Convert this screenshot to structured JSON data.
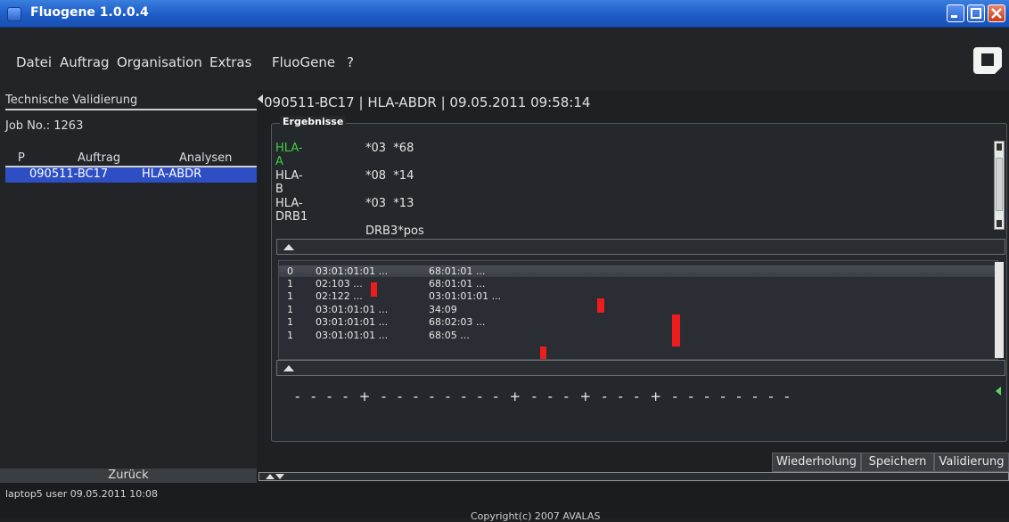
{
  "window": {
    "title": "Fluogene 1.0.0.4"
  },
  "menu": [
    "Datei",
    "Auftrag",
    "Organisation",
    "Extras",
    "FluoGene",
    "?"
  ],
  "left_panel": {
    "heading": "Technische Validierung",
    "job_no": "Job No.: 1263",
    "columns": [
      "P",
      "Auftrag",
      "Analysen"
    ],
    "rows": [
      {
        "p": "",
        "auftrag": "090511-BC17",
        "analysen": "HLA-ABDR",
        "selected": true
      }
    ],
    "back_button": "Zurück"
  },
  "main": {
    "header": "090511-BC17  |  HLA-ABDR  |  09.05.2011 09:58:14",
    "group_title": "Ergebnisse",
    "results": [
      {
        "locus": "HLA-A",
        "alleles": "*03  *68",
        "color": "#3fcf3f"
      },
      {
        "locus": "HLA-B",
        "alleles": "*08  *14",
        "color": "#e8e8e8"
      },
      {
        "locus": "HLA-DRB1",
        "alleles": "*03  *13",
        "color": "#e8e8e8"
      },
      {
        "locus": "",
        "alleles": "DRB3*pos",
        "color": "#e8e8e8"
      }
    ],
    "candidates": [
      {
        "p": "0",
        "a1": "03:01:01:01 ...",
        "a2": "68:01:01 ..."
      },
      {
        "p": "1",
        "a1": "02:103 ...",
        "a2": "68:01:01 ..."
      },
      {
        "p": "1",
        "a1": "02:122 ...",
        "a2": "03:01:01:01 ..."
      },
      {
        "p": "1",
        "a1": "03:01:01:01 ...",
        "a2": "34:09"
      },
      {
        "p": "1",
        "a1": "03:01:01:01 ...",
        "a2": "68:02:03 ..."
      },
      {
        "p": "1",
        "a1": "03:01:01:01 ...",
        "a2": "68:05 ..."
      }
    ],
    "pattern": "-  -  -  -  +  -  -  -  -  -  -  -  -  +  -  -  -  +  -  -  -  +  -  -  -  -  -  -  -  -"
  },
  "actions": [
    "Wiederholung",
    "Speichern",
    "Validierung"
  ],
  "status": {
    "user_line": "laptop5 user 09.05.2011 10:08",
    "copyright": "Copyright(c) 2007 AVALAS"
  },
  "icons": [
    "app-icon",
    "minimize-icon",
    "maximize-icon",
    "close-icon",
    "brand-logo-icon",
    "collapse-arrow-icon",
    "scroll-up-icon",
    "scroll-down-icon",
    "expand-arrow-icon"
  ],
  "colors": {
    "titlebar": "#1d5cc7",
    "selection": "#2e4fc4",
    "highlight_green": "#3fcf3f",
    "mark_red": "#ee1c1c"
  }
}
